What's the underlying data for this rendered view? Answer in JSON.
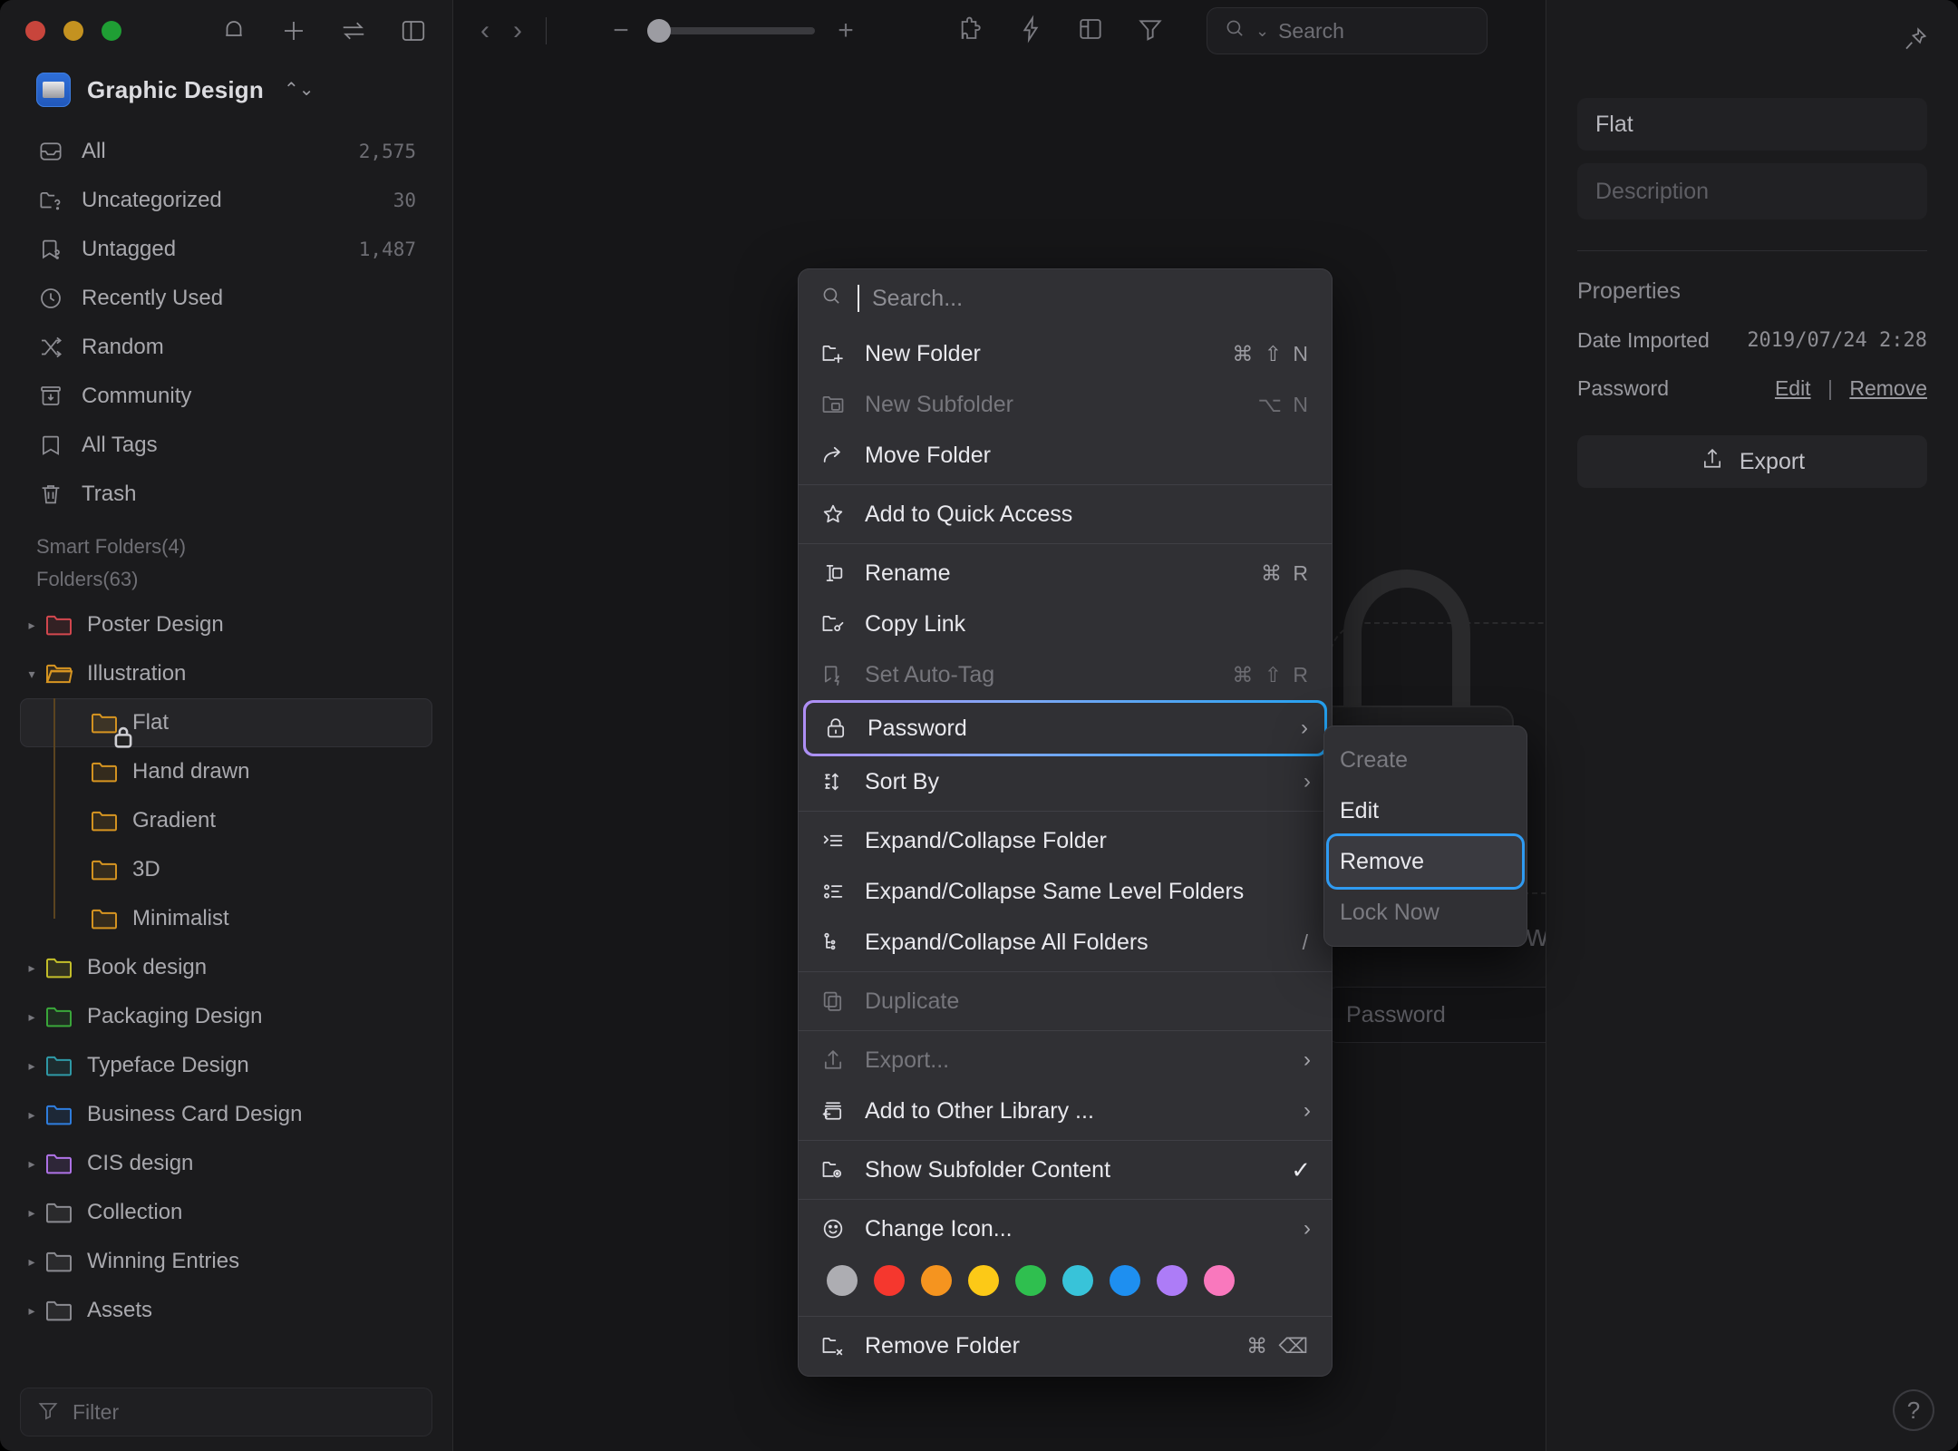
{
  "window": {
    "traffic_lights": [
      "#c8453c",
      "#c49220",
      "#1f9e34"
    ],
    "toolbar_icons": [
      "bell-icon",
      "plus-icon",
      "sync-icon",
      "panel-toggle-icon"
    ]
  },
  "sidebar": {
    "library": {
      "name": "Graphic Design",
      "icon": "library-icon"
    },
    "nav": [
      {
        "label": "All",
        "count": "2,575",
        "icon": "inbox-icon"
      },
      {
        "label": "Uncategorized",
        "count": "30",
        "icon": "folder-question-icon"
      },
      {
        "label": "Untagged",
        "count": "1,487",
        "icon": "tag-question-icon"
      },
      {
        "label": "Recently Used",
        "count": "",
        "icon": "clock-icon"
      },
      {
        "label": "Random",
        "count": "",
        "icon": "shuffle-icon"
      },
      {
        "label": "Community",
        "count": "",
        "icon": "community-icon"
      },
      {
        "label": "All Tags",
        "count": "",
        "icon": "bookmark-icon"
      },
      {
        "label": "Trash",
        "count": "",
        "icon": "trash-icon"
      }
    ],
    "smart_folders_label": "Smart Folders(4)",
    "folders_label": "Folders(63)",
    "folders": [
      {
        "label": "Poster Design",
        "color": "#d4484f",
        "depth": 0,
        "expandable": true,
        "expanded": false,
        "selected": false,
        "locked": false
      },
      {
        "label": "Illustration",
        "color": "#d79521",
        "depth": 0,
        "expandable": true,
        "expanded": true,
        "selected": false,
        "locked": false
      },
      {
        "label": "Flat",
        "color": "#d79521",
        "depth": 1,
        "expandable": false,
        "expanded": false,
        "selected": true,
        "locked": true
      },
      {
        "label": "Hand drawn",
        "color": "#d79521",
        "depth": 1,
        "expandable": false,
        "expanded": false,
        "selected": false,
        "locked": false
      },
      {
        "label": "Gradient",
        "color": "#d79521",
        "depth": 1,
        "expandable": false,
        "expanded": false,
        "selected": false,
        "locked": false
      },
      {
        "label": "3D",
        "color": "#d79521",
        "depth": 1,
        "expandable": false,
        "expanded": false,
        "selected": false,
        "locked": false
      },
      {
        "label": "Minimalist",
        "color": "#d79521",
        "depth": 1,
        "expandable": false,
        "expanded": false,
        "selected": false,
        "locked": false
      },
      {
        "label": "Book design",
        "color": "#c5c02a",
        "depth": 0,
        "expandable": true,
        "expanded": false,
        "selected": false,
        "locked": false
      },
      {
        "label": "Packaging Design",
        "color": "#3aa83a",
        "depth": 0,
        "expandable": true,
        "expanded": false,
        "selected": false,
        "locked": false
      },
      {
        "label": "Typeface Design",
        "color": "#2f9aa8",
        "depth": 0,
        "expandable": true,
        "expanded": false,
        "selected": false,
        "locked": false
      },
      {
        "label": "Business Card Design",
        "color": "#2f7ee0",
        "depth": 0,
        "expandable": true,
        "expanded": false,
        "selected": false,
        "locked": false
      },
      {
        "label": "CIS design",
        "color": "#b073e8",
        "depth": 0,
        "expandable": true,
        "expanded": false,
        "selected": false,
        "locked": false
      },
      {
        "label": "Collection",
        "color": "#8b8b91",
        "depth": 0,
        "expandable": true,
        "expanded": false,
        "selected": false,
        "locked": false
      },
      {
        "label": "Winning Entries",
        "color": "#8b8b91",
        "depth": 0,
        "expandable": true,
        "expanded": false,
        "selected": false,
        "locked": false
      },
      {
        "label": "Assets",
        "color": "#8b8b91",
        "depth": 0,
        "expandable": true,
        "expanded": false,
        "selected": false,
        "locked": false
      }
    ],
    "filter_placeholder": "Filter"
  },
  "toolbar": {
    "back_icon": "chevron-left-icon",
    "forward_icon": "chevron-right-icon",
    "zoom_minus": "−",
    "zoom_plus": "+",
    "tool_icons": [
      "extension-icon",
      "lightning-icon",
      "layout-icon",
      "filter-icon"
    ],
    "search_placeholder": "Search"
  },
  "content": {
    "lock_message": "Enter the password to view contents",
    "password_placeholder": "Password"
  },
  "context_menu": {
    "search_placeholder": "Search...",
    "groups": [
      [
        {
          "label": "New Folder",
          "shortcut": "⌘ ⇧ N",
          "icon": "new-folder-icon",
          "disabled": false,
          "submenu": false,
          "checked": false
        },
        {
          "label": "New Subfolder",
          "shortcut": "⌥ N",
          "icon": "new-subfolder-icon",
          "disabled": true,
          "submenu": false,
          "checked": false
        },
        {
          "label": "Move Folder",
          "shortcut": "",
          "icon": "move-folder-icon",
          "disabled": false,
          "submenu": false,
          "checked": false
        }
      ],
      [
        {
          "label": "Add to Quick Access",
          "shortcut": "",
          "icon": "star-icon",
          "disabled": false,
          "submenu": false,
          "checked": false
        }
      ],
      [
        {
          "label": "Rename",
          "shortcut": "⌘ R",
          "icon": "rename-icon",
          "disabled": false,
          "submenu": false,
          "checked": false
        },
        {
          "label": "Copy Link",
          "shortcut": "",
          "icon": "copy-link-icon",
          "disabled": false,
          "submenu": false,
          "checked": false
        },
        {
          "label": "Set Auto-Tag",
          "shortcut": "⌘ ⇧ R",
          "icon": "auto-tag-icon",
          "disabled": true,
          "submenu": false,
          "checked": false
        },
        {
          "label": "Password",
          "shortcut": "",
          "icon": "lock-icon",
          "disabled": false,
          "submenu": true,
          "checked": false,
          "highlighted": true
        },
        {
          "label": "Sort By",
          "shortcut": "",
          "icon": "sort-icon",
          "disabled": false,
          "submenu": true,
          "checked": false
        }
      ],
      [
        {
          "label": "Expand/Collapse Folder",
          "shortcut": "",
          "icon": "expand-folder-icon",
          "disabled": false,
          "submenu": false,
          "checked": false
        },
        {
          "label": "Expand/Collapse Same Level Folders",
          "shortcut": "",
          "icon": "expand-same-level-icon",
          "disabled": false,
          "submenu": false,
          "checked": false
        },
        {
          "label": "Expand/Collapse All Folders",
          "shortcut": "/",
          "icon": "expand-all-icon",
          "disabled": false,
          "submenu": false,
          "checked": false
        }
      ],
      [
        {
          "label": "Duplicate",
          "shortcut": "",
          "icon": "duplicate-icon",
          "disabled": true,
          "submenu": false,
          "checked": false
        }
      ],
      [
        {
          "label": "Export...",
          "shortcut": "",
          "icon": "export-icon",
          "disabled": true,
          "submenu": true,
          "checked": false
        },
        {
          "label": "Add to Other Library ...",
          "shortcut": "",
          "icon": "add-library-icon",
          "disabled": false,
          "submenu": true,
          "checked": false
        }
      ],
      [
        {
          "label": "Show Subfolder Content",
          "shortcut": "",
          "icon": "subfolder-content-icon",
          "disabled": false,
          "submenu": false,
          "checked": true
        }
      ],
      [
        {
          "label": "Change Icon...",
          "shortcut": "",
          "icon": "smiley-icon",
          "disabled": false,
          "submenu": true,
          "checked": false
        }
      ],
      [
        {
          "label": "Remove Folder",
          "shortcut": "⌘ ⌫",
          "icon": "remove-folder-icon",
          "disabled": false,
          "submenu": false,
          "checked": false
        }
      ]
    ],
    "color_swatches": [
      "#adadb2",
      "#f5372e",
      "#f5941f",
      "#fcc917",
      "#2fbf4f",
      "#38c3d9",
      "#1e8ff0",
      "#ad7cf7",
      "#f978bd"
    ]
  },
  "submenu": {
    "items": [
      {
        "label": "Create",
        "disabled": true,
        "selected": false
      },
      {
        "label": "Edit",
        "disabled": false,
        "selected": false
      },
      {
        "label": "Remove",
        "disabled": false,
        "selected": true
      },
      {
        "label": "Lock Now",
        "disabled": true,
        "selected": false
      }
    ]
  },
  "inspector": {
    "pin_icon": "pin-icon",
    "name_value": "Flat",
    "description_placeholder": "Description",
    "properties_title": "Properties",
    "date_imported_label": "Date Imported",
    "date_imported_value": "2019/07/24 2:28",
    "password_label": "Password",
    "password_edit": "Edit",
    "password_separator": "|",
    "password_remove": "Remove",
    "export_label": "Export",
    "help_label": "?"
  }
}
